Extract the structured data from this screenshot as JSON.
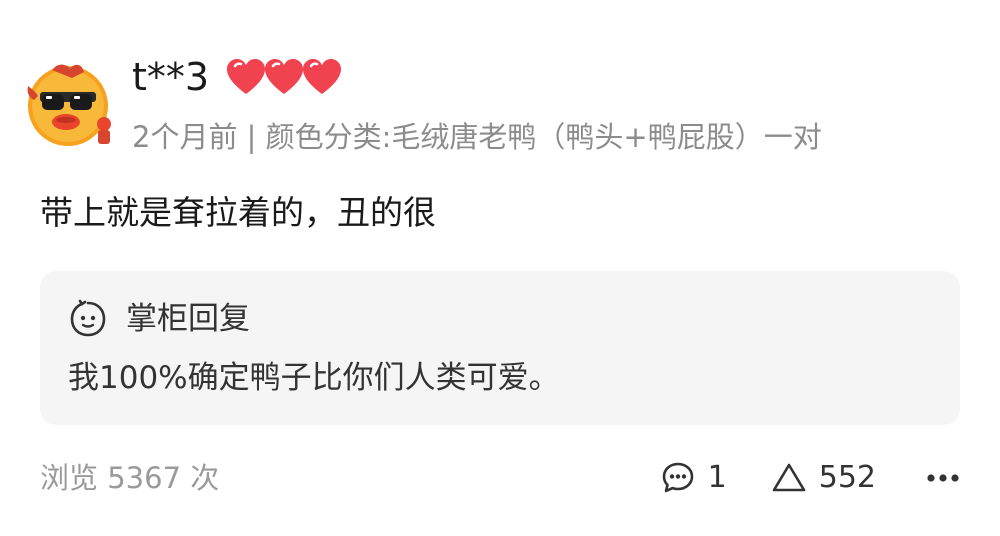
{
  "comment_card": {
    "user": {
      "name": "t**3",
      "avatar_icon": "duck-cartoon-avatar-icon",
      "hearts_icon": "heart-icon",
      "heart_count": 3
    },
    "meta": "2个月前 | 颜色分类:毛绒唐老鸭（鸭头+鸭屁股）一对",
    "text": "带上就是耷拉着的，丑的很",
    "reply": {
      "icon": "smiley-face-icon",
      "title": "掌柜回复",
      "text": "我100%确定鸭子比你们人类可爱。"
    },
    "footer": {
      "views": "浏览 5367 次",
      "comment_icon": "comment-bubble-icon",
      "comment_count": "1",
      "like_icon": "triangle-like-icon",
      "like_count": "552",
      "more_icon": "more-dots-icon"
    }
  },
  "colors": {
    "heart": "#f0424f",
    "reply_bg": "#f5f5f5",
    "meta_text": "#8c8c8c"
  }
}
